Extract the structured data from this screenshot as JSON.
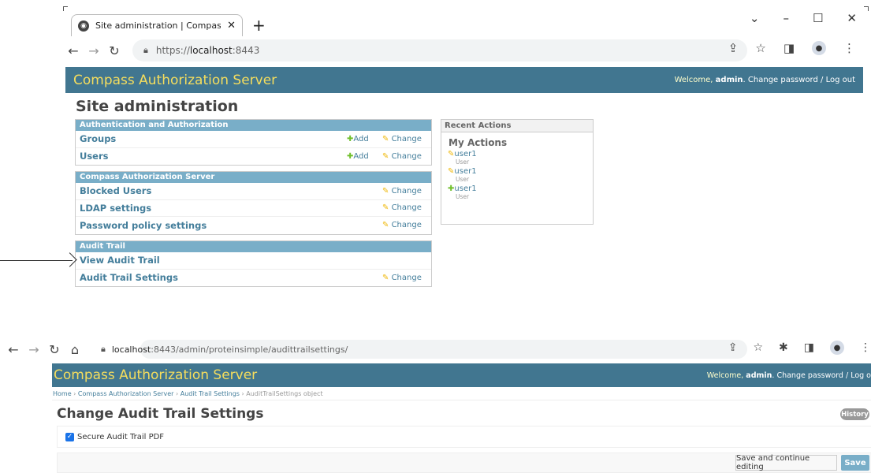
{
  "top_browser": {
    "tab_title": "Site administration | Compass Au",
    "tab_close": "✕",
    "new_tab": "+",
    "url_prefix": "https://",
    "url_host": "localhost",
    "url_port": ":8443",
    "win_minimize": "–",
    "win_maximize": "☐",
    "win_close": "✕",
    "chevron": "⌄"
  },
  "admin_home": {
    "brand": "Compass Authorization Server",
    "welcome": "Welcome, ",
    "user": "admin",
    "links": ". Change password / Log out",
    "title": "Site administration",
    "modules": [
      {
        "caption": "Authentication and Authorization",
        "rows": [
          {
            "name": "Groups",
            "add": "Add",
            "change": "Change"
          },
          {
            "name": "Users",
            "add": "Add",
            "change": "Change"
          }
        ]
      },
      {
        "caption": "Compass Authorization Server",
        "rows": [
          {
            "name": "Blocked Users",
            "change": "Change"
          },
          {
            "name": "LDAP settings",
            "change": "Change"
          },
          {
            "name": "Password policy settings",
            "change": "Change"
          }
        ]
      },
      {
        "caption": "Audit Trail",
        "rows": [
          {
            "name": "View Audit Trail"
          },
          {
            "name": "Audit Trail Settings",
            "change": "Change"
          }
        ]
      }
    ],
    "recent": {
      "caption": "Recent Actions",
      "heading": "My Actions",
      "items": [
        {
          "name": "user1",
          "type": "User"
        },
        {
          "name": "user1",
          "type": "User"
        },
        {
          "name": "user1",
          "type": "User"
        }
      ]
    }
  },
  "bottom_browser": {
    "url_host": "localhost",
    "url_path": ":8443/admin/proteinsimple/audittrailsettings/"
  },
  "change_page": {
    "brand": "Compass Authorization Server",
    "welcome": "Welcome, ",
    "user": "admin",
    "links": ". Change password / Log o",
    "breadcrumbs": [
      "Home",
      "Compass Authorization Server",
      "Audit Trail Settings",
      "AuditTrailSettings object"
    ],
    "title": "Change Audit Trail Settings",
    "history": "History",
    "checkbox_label": "Secure Audit Trail PDF",
    "checkbox_checked": true,
    "save_continue": "Save and continue editing",
    "save": "Save"
  },
  "colors": {
    "header_bg": "#417690",
    "brand_yellow": "#f5dd5d",
    "caption_blue": "#79aec8",
    "link_blue": "#447e9b"
  }
}
